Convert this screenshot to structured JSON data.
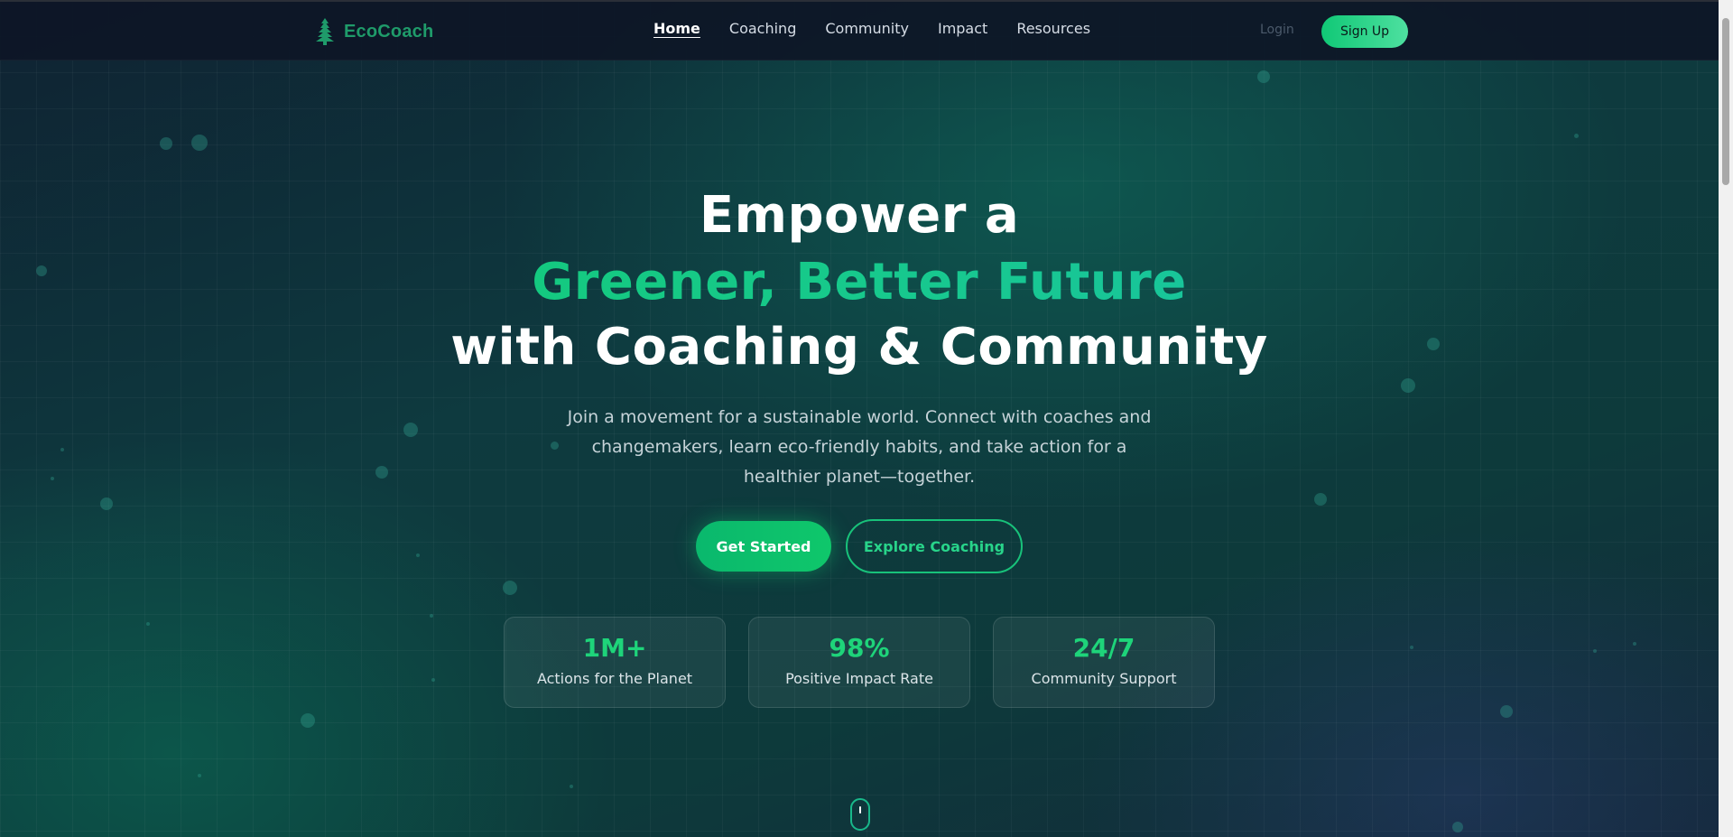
{
  "brand": {
    "name": "EcoCoach",
    "logo_icon": "tree-icon",
    "color": "#1f9b6a"
  },
  "nav": {
    "links": [
      {
        "label": "Home",
        "active": true
      },
      {
        "label": "Coaching",
        "active": false
      },
      {
        "label": "Community",
        "active": false
      },
      {
        "label": "Impact",
        "active": false
      },
      {
        "label": "Resources",
        "active": false
      }
    ],
    "login_label": "Login",
    "signup_label": "Sign Up"
  },
  "hero": {
    "title_line1": "Empower a",
    "title_line2": "Greener, Better Future",
    "title_line3": "with Coaching & Community",
    "subtitle": "Join a movement for a sustainable world. Connect with coaches and changemakers, learn eco-friendly habits, and take action for a healthier planet—together.",
    "primary_cta": "Get Started",
    "secondary_cta": "Explore Coaching",
    "scroll_icon": "mouse-scroll-icon"
  },
  "stats": [
    {
      "value": "1M+",
      "label": "Actions for the Planet"
    },
    {
      "value": "98%",
      "label": "Positive Impact Rate"
    },
    {
      "value": "24/7",
      "label": "Community Support"
    }
  ],
  "colors": {
    "accent": "#10c876",
    "accent_teal": "#1bbfb0",
    "background": "#0f1b2a"
  }
}
